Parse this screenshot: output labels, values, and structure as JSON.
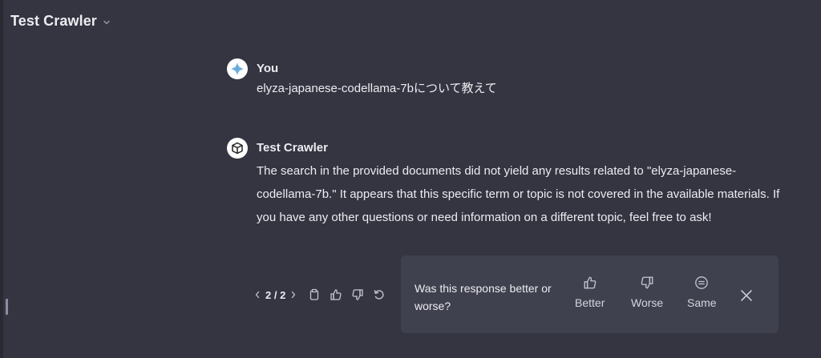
{
  "header": {
    "title": "Test Crawler",
    "chevron_icon": "chevron-down-icon"
  },
  "messages": [
    {
      "author": "You",
      "avatar_icon": "user-avatar-icon",
      "text": "elyza-japanese-codellama-7bについて教えて"
    },
    {
      "author": "Test Crawler",
      "avatar_icon": "cube-icon",
      "text": "The search in the provided documents did not yield any results related to \"elyza-japanese-codellama-7b.\" It appears that this specific term or topic is not covered in the available materials. If you have any other questions or need information on a different topic, feel free to ask!"
    }
  ],
  "actions": {
    "pager": "2 / 2",
    "icons": [
      "chevron-left-icon",
      "chevron-right-icon",
      "clipboard-icon",
      "thumbs-up-icon",
      "thumbs-down-icon",
      "regenerate-icon"
    ]
  },
  "feedback": {
    "question": "Was this response better or worse?",
    "options": [
      {
        "label": "Better",
        "icon": "thumbs-up-icon"
      },
      {
        "label": "Worse",
        "icon": "thumbs-down-icon"
      },
      {
        "label": "Same",
        "icon": "equal-circle-icon"
      }
    ],
    "close_icon": "close-icon"
  },
  "colors": {
    "background": "#343541",
    "panel": "#40414f",
    "text": "#ececf1",
    "muted": "#c5c5d2"
  }
}
